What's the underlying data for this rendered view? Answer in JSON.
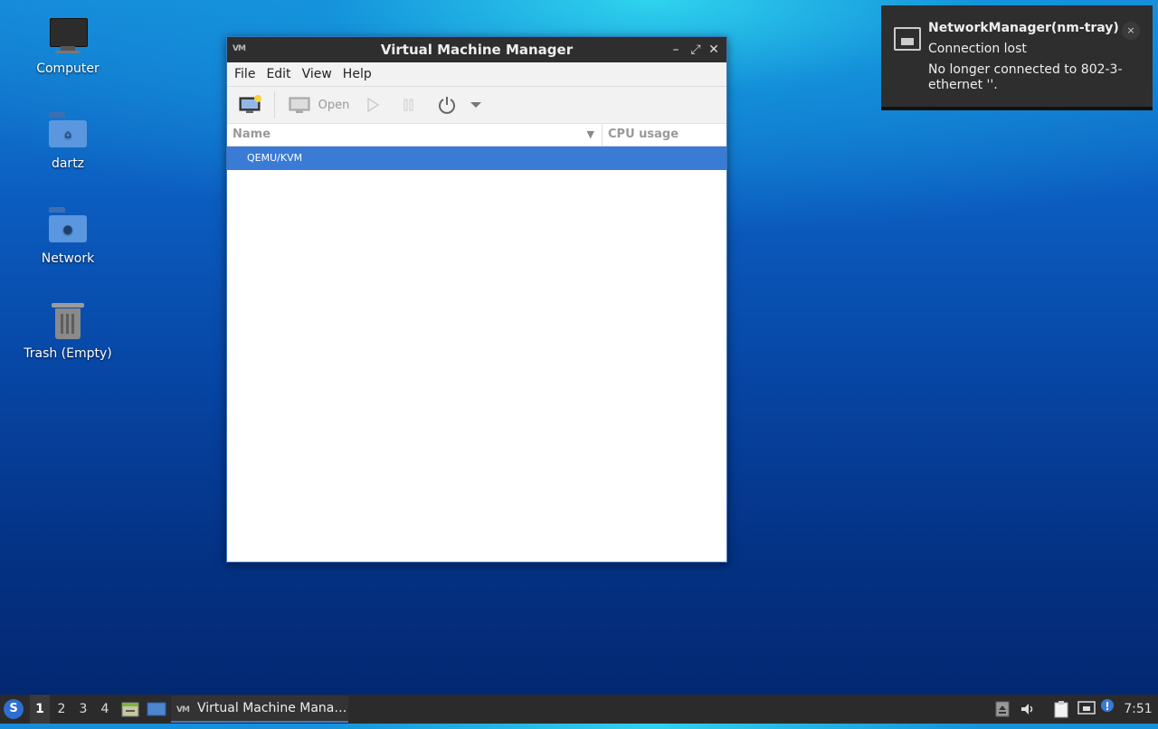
{
  "desktop": {
    "icons": [
      {
        "label": "Computer"
      },
      {
        "label": "dartz"
      },
      {
        "label": "Network"
      },
      {
        "label": "Trash (Empty)"
      }
    ]
  },
  "window": {
    "title": "Virtual Machine Manager",
    "menu": [
      "File",
      "Edit",
      "View",
      "Help"
    ],
    "toolbar": {
      "open_label": "Open"
    },
    "columns": {
      "name": "Name",
      "cpu": "CPU usage"
    },
    "rows": [
      {
        "name": "QEMU/KVM",
        "selected": true
      }
    ]
  },
  "notification": {
    "title": "NetworkManager(nm-tray)",
    "subtitle": "Connection lost",
    "body": "No longer connected to 802-3-ethernet ''.",
    "close": "×"
  },
  "taskbar": {
    "workspaces": [
      "1",
      "2",
      "3",
      "4"
    ],
    "active_workspace": "1",
    "task_label": "Virtual Machine Mana…",
    "clock": "7:51"
  },
  "colors": {
    "accent": "#3a7bd5",
    "titlebar": "#2e2e2e"
  }
}
